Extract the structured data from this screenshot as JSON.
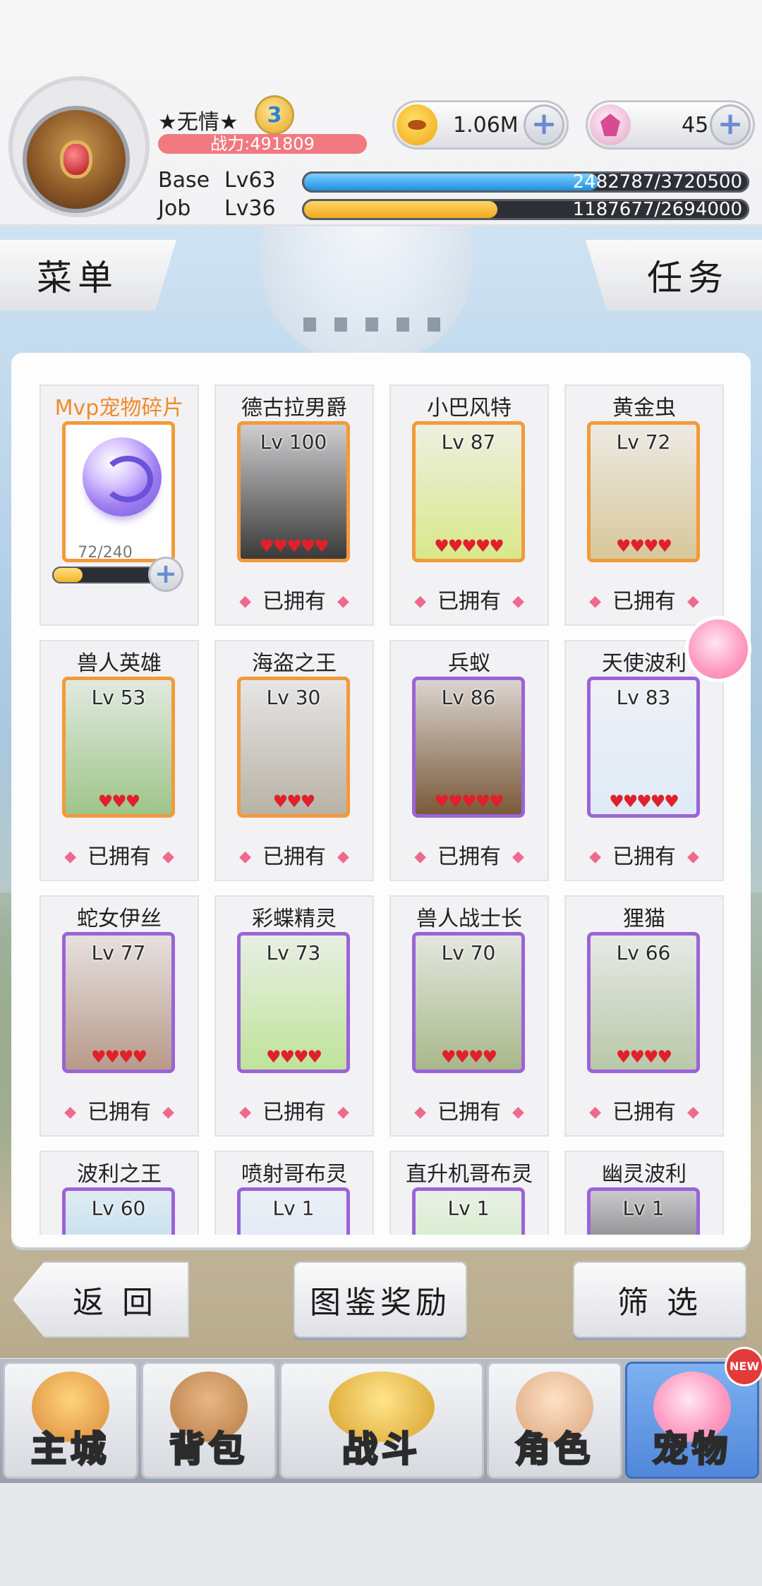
{
  "player": {
    "name": "★无情★",
    "rank": "3",
    "power": "战力:491809",
    "base_label": "Base",
    "base_level": "Lv63",
    "base_exp": "2482787/3720500",
    "base_progress": 0.667,
    "job_label": "Job",
    "job_level": "Lv36",
    "job_exp": "1187677/2694000",
    "job_progress": 0.441
  },
  "currency": {
    "zeny": "1.06M",
    "gems": "45"
  },
  "tabs": {
    "menu": "菜单",
    "tasks": "任务"
  },
  "mvp": {
    "title": "Mvp宠物碎片",
    "progress_text": "72/240",
    "progress": 0.3
  },
  "owned_label": "已拥有",
  "pets": [
    {
      "name": "德古拉男爵",
      "level": "Lv 100",
      "hearts": "♥♥♥♥♥",
      "frame": "orange"
    },
    {
      "name": "小巴风特",
      "level": "Lv 87",
      "hearts": "♥♥♥♥♥",
      "frame": "orange"
    },
    {
      "name": "黄金虫",
      "level": "Lv 72",
      "hearts": "♥♥♥♥",
      "frame": "orange"
    },
    {
      "name": "兽人英雄",
      "level": "Lv 53",
      "hearts": "♥♥♥",
      "frame": "orange"
    },
    {
      "name": "海盗之王",
      "level": "Lv 30",
      "hearts": "♥♥♥",
      "frame": "orange"
    },
    {
      "name": "兵蚁",
      "level": "Lv 86",
      "hearts": "♥♥♥♥♥",
      "frame": "purple"
    },
    {
      "name": "天使波利",
      "level": "Lv 83",
      "hearts": "♥♥♥♥♥",
      "frame": "purple"
    },
    {
      "name": "蛇女伊丝",
      "level": "Lv 77",
      "hearts": "♥♥♥♥",
      "frame": "purple"
    },
    {
      "name": "彩蝶精灵",
      "level": "Lv 73",
      "hearts": "♥♥♥♥",
      "frame": "purple"
    },
    {
      "name": "兽人战士长",
      "level": "Lv 70",
      "hearts": "♥♥♥♥",
      "frame": "purple"
    },
    {
      "name": "狸猫",
      "level": "Lv 66",
      "hearts": "♥♥♥♥",
      "frame": "purple"
    },
    {
      "name": "波利之王",
      "level": "Lv 60",
      "hearts": "",
      "frame": "purple"
    },
    {
      "name": "喷射哥布灵",
      "level": "Lv 1",
      "hearts": "",
      "frame": "purple"
    },
    {
      "name": "直升机哥布灵",
      "level": "Lv 1",
      "hearts": "",
      "frame": "purple"
    },
    {
      "name": "幽灵波利",
      "level": "Lv 1",
      "hearts": "",
      "frame": "purple"
    }
  ],
  "actions": {
    "back": "返 回",
    "rewards": "图鉴奖励",
    "filter": "筛 选"
  },
  "nav": [
    {
      "label": "主城",
      "icon": "castle-icon"
    },
    {
      "label": "背包",
      "icon": "backpack-icon"
    },
    {
      "label": "战斗",
      "icon": "crossed-swords-icon"
    },
    {
      "label": "角色",
      "icon": "character-icon"
    },
    {
      "label": "宠物",
      "icon": "poring-icon",
      "active": true
    }
  ],
  "new_badge": "NEW",
  "colors": {
    "orange_frame": "#f29a3b",
    "purple_frame": "#9b63d8",
    "heart": "#e0202a",
    "active_nav": "#4f86d9"
  }
}
